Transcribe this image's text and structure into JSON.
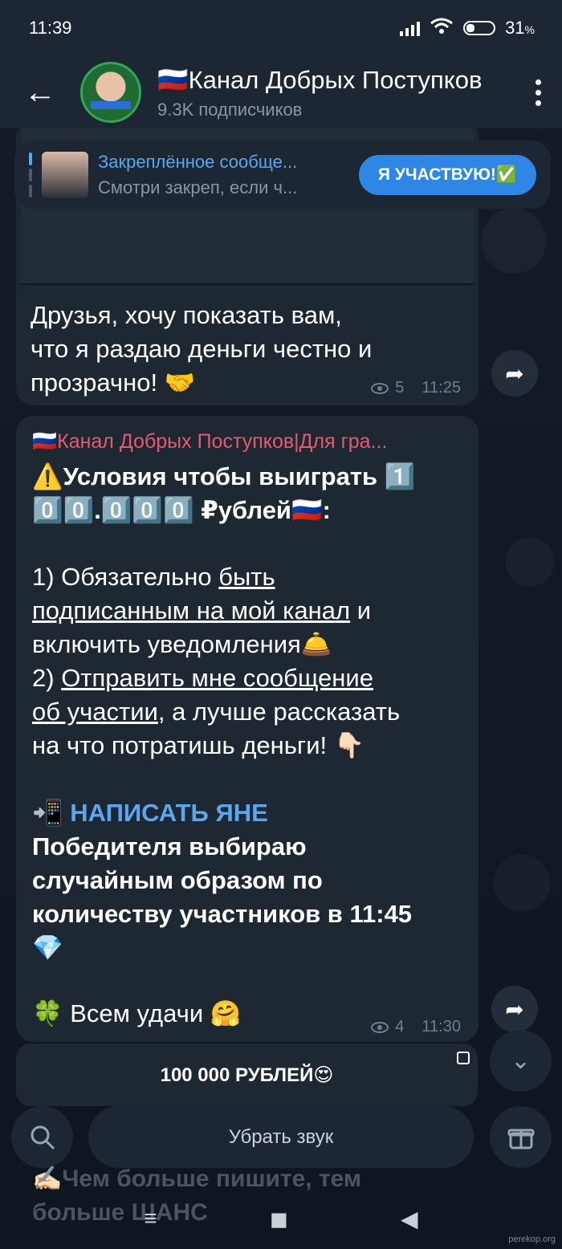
{
  "status_bar": {
    "time": "11:39",
    "battery": "31"
  },
  "header": {
    "title": "🇷🇺Канал Добрых Поступков",
    "subscribers": "9.3K подписчиков",
    "back": "←"
  },
  "pinned": {
    "title": "Закреплённое сообще...",
    "subtitle": "Смотри закреп, если ч...",
    "button": "Я УЧАСТВУЮ!✅"
  },
  "messages": [
    {
      "text_lines": [
        "Друзья, хочу показать вам,",
        "что я раздаю деньги честно и",
        "прозрачно! 🤝"
      ],
      "views": "5",
      "time": "11:25"
    },
    {
      "forwarded_from": "🇷🇺Канал Добрых Поступков|Для гра...",
      "line1": "⚠️Условия чтобы выиграть 1️⃣",
      "line2": "0️⃣0️⃣.0️⃣0️⃣0️⃣ ₽ублей🇷🇺:",
      "c1_prefix": "1) Обязательно ",
      "c1_link1": "быть",
      "c1_link2": "подписанным на мой канал",
      "c1_rest": " и",
      "c1_line3": "включить уведомления🛎️",
      "c2_prefix": "2) ",
      "c2_link1": "Отправить мне сообщение",
      "c2_link2": "об участии",
      "c2_rest": ", а лучше рассказать",
      "c2_line3": "на что потратишь деньги! 👇🏻",
      "cta_icon": "📲",
      "cta_text": "НАПИСАТЬ ЯНЕ",
      "winner_lines": [
        "Победителя выбираю",
        "случайным образом по",
        "количеству участников в 11:45",
        "💎"
      ],
      "luck": "🍀 Всем удачи 🤗",
      "views": "4",
      "time": "11:30"
    }
  ],
  "keyboard_button": "100 000 РУБЛЕЙ😍",
  "mute_label": "Убрать звук",
  "ghost_text_lines": [
    "✍🏻Чем больше пишите, тем",
    "больше ШАНС"
  ],
  "watermark": "perekop.org"
}
